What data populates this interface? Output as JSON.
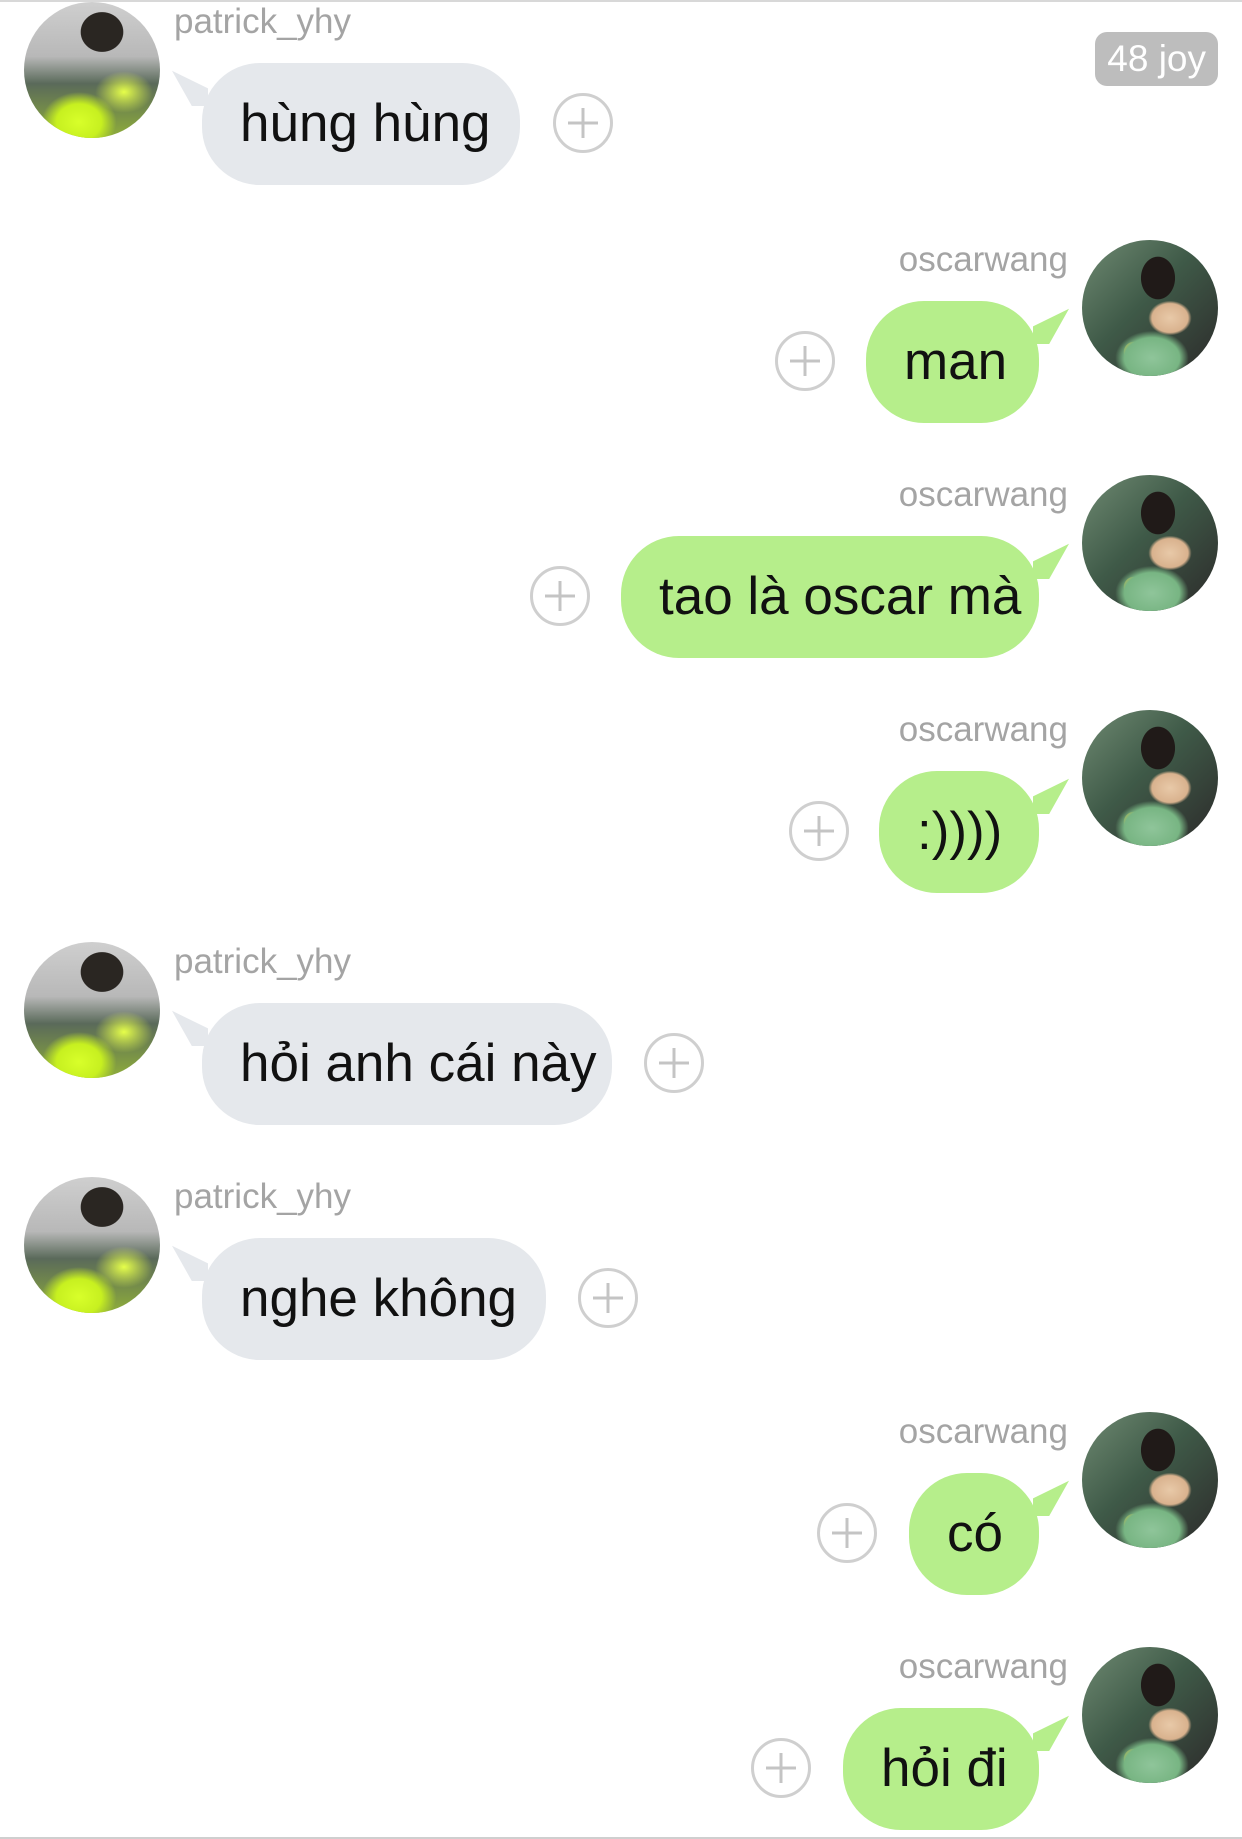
{
  "header": {
    "badge": "48 joy"
  },
  "messages": [
    {
      "sender": "patrick_yhy",
      "side": "left",
      "text": "hùng hùng"
    },
    {
      "sender": "oscarwang",
      "side": "right",
      "text": "man"
    },
    {
      "sender": "oscarwang",
      "side": "right",
      "text": "tao là oscar mà"
    },
    {
      "sender": "oscarwang",
      "side": "right",
      "text": ":))))"
    },
    {
      "sender": "patrick_yhy",
      "side": "left",
      "text": "hỏi anh cái này"
    },
    {
      "sender": "patrick_yhy",
      "side": "left",
      "text": "nghe không"
    },
    {
      "sender": "oscarwang",
      "side": "right",
      "text": "có"
    },
    {
      "sender": "oscarwang",
      "side": "right",
      "text": "hỏi đi"
    }
  ],
  "colors": {
    "incoming_bubble": "#e5e8ec",
    "outgoing_bubble": "#b6ee8b",
    "username": "#a4a4a4",
    "badge_bg": "#bdbdbd"
  },
  "icons": {
    "add_reaction": "plus-circle-icon",
    "avatar": "user-avatar"
  }
}
